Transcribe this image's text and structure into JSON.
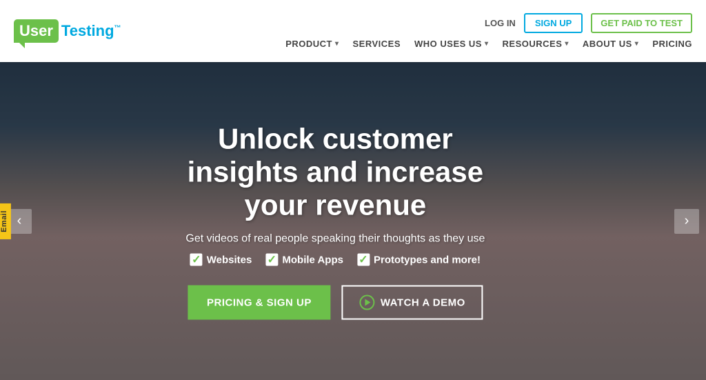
{
  "header": {
    "logo_user": "User",
    "logo_testing": "Testing",
    "logo_tm": "™",
    "nav_login": "LOG IN",
    "nav_signup": "SIGN UP",
    "nav_get_paid": "GET PAID TO TEST",
    "main_nav": [
      {
        "label": "PRODUCT",
        "has_dropdown": true
      },
      {
        "label": "SERVICES",
        "has_dropdown": false
      },
      {
        "label": "WHO USES US",
        "has_dropdown": true
      },
      {
        "label": "RESOURCES",
        "has_dropdown": true
      },
      {
        "label": "ABOUT US",
        "has_dropdown": true
      },
      {
        "label": "PRICING",
        "has_dropdown": false
      }
    ]
  },
  "hero": {
    "title": "Unlock customer insights and increase your revenue",
    "subtitle": "Get videos of real people speaking their thoughts as they use",
    "checkboxes": [
      {
        "label": "Websites"
      },
      {
        "label": "Mobile Apps"
      },
      {
        "label": "Prototypes and more!"
      }
    ],
    "btn_pricing": "PRICING & SIGN UP",
    "btn_demo": "WATCH A DEMO",
    "arrow_left": "‹",
    "arrow_right": "›",
    "email_tab": "Email"
  }
}
